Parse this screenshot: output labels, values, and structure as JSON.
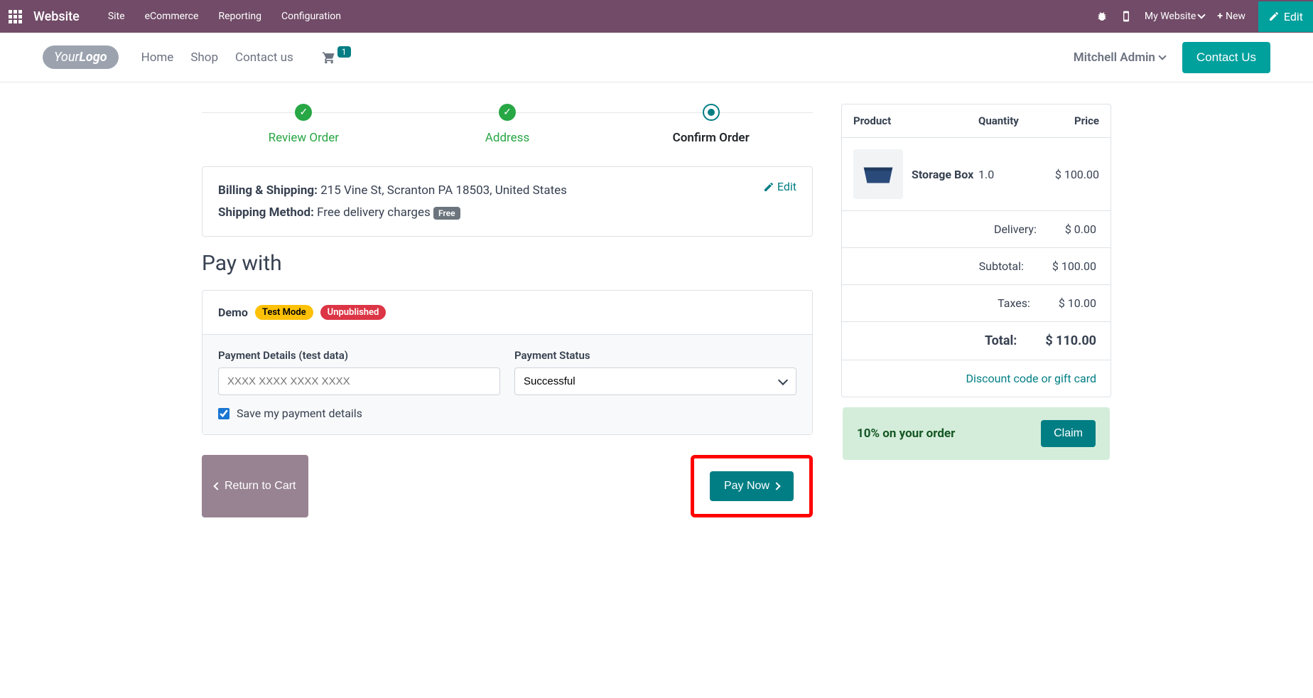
{
  "topbar": {
    "title": "Website",
    "menu": [
      "Site",
      "eCommerce",
      "Reporting",
      "Configuration"
    ],
    "website_switch": "My Website",
    "new_btn": "New",
    "edit_btn": "Edit"
  },
  "header": {
    "logo_your": "Your",
    "logo_logo": "Logo",
    "nav": [
      "Home",
      "Shop",
      "Contact us"
    ],
    "cart_count": "1",
    "user": "Mitchell Admin",
    "contact_btn": "Contact Us"
  },
  "steps": {
    "review": "Review Order",
    "address": "Address",
    "confirm": "Confirm Order"
  },
  "address": {
    "billing_label": "Billing & Shipping:",
    "billing_value": "215 Vine St, Scranton PA 18503, United States",
    "shipping_label": "Shipping Method:",
    "shipping_value": "Free delivery charges",
    "free_badge": "Free",
    "edit": "Edit"
  },
  "pay_with_heading": "Pay with",
  "payment": {
    "provider": "Demo",
    "test_badge": "Test Mode",
    "unpub_badge": "Unpublished",
    "details_label": "Payment Details (test data)",
    "details_placeholder": "XXXX XXXX XXXX XXXX",
    "status_label": "Payment Status",
    "status_value": "Successful",
    "save_label": "Save my payment details"
  },
  "buttons": {
    "return": "Return to Cart",
    "pay_now": "Pay Now"
  },
  "summary": {
    "head_product": "Product",
    "head_qty": "Quantity",
    "head_price": "Price",
    "item_name": "Storage Box",
    "item_qty": "1.0",
    "item_price": "$ 100.00",
    "delivery_label": "Delivery:",
    "delivery_value": "$ 0.00",
    "subtotal_label": "Subtotal:",
    "subtotal_value": "$ 100.00",
    "taxes_label": "Taxes:",
    "taxes_value": "$ 10.00",
    "total_label": "Total:",
    "total_value": "$ 110.00",
    "discount_link": "Discount code or gift card",
    "promo_text": "10% on your order",
    "claim_btn": "Claim"
  }
}
